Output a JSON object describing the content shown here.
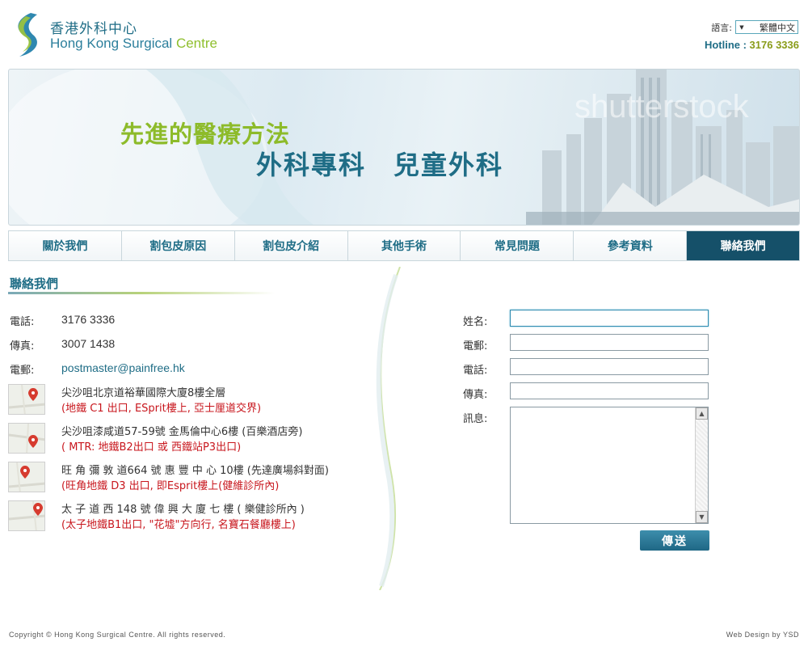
{
  "header": {
    "logo_cn": "香港外科中心",
    "logo_en_main": "Hong Kong Surgical ",
    "logo_en_accent": "Centre",
    "lang_label": "語言:",
    "lang_value": "繁體中文",
    "hotline_label": "Hotline : ",
    "hotline_number": "3176 3336"
  },
  "banner": {
    "line1": "先進的醫療方法",
    "line2": "外科專科　兒童外科",
    "watermark": "shutterstock"
  },
  "nav": {
    "items": [
      {
        "label": "關於我們"
      },
      {
        "label": "割包皮原因"
      },
      {
        "label": "割包皮介紹"
      },
      {
        "label": "其他手術"
      },
      {
        "label": "常見問題"
      },
      {
        "label": "參考資料"
      },
      {
        "label": "聯絡我們"
      }
    ],
    "active_index": 6
  },
  "contact": {
    "title": "聯絡我們",
    "phone_label": "電話:",
    "phone": "3176 3336",
    "fax_label": "傳真:",
    "fax": "3007 1438",
    "email_label": "電郵:",
    "email": "postmaster@painfree.hk",
    "addresses": [
      {
        "line1": "尖沙咀北京道裕華國際大廈8樓全層",
        "line2": "(地鐵 C1 出口, ESprit樓上, 亞士厘道交界)"
      },
      {
        "line1": "尖沙咀漆咸道57-59號 金馬倫中心6樓 (百樂酒店旁)",
        "line2": "( MTR: 地鐵B2出口 或 西鐵站P3出口)"
      },
      {
        "line1": "旺 角 彌 敦 道664 號 惠 豐 中 心 10樓 (先達廣場斜對面)",
        "line2": "(旺角地鐵 D3 出口, 即Esprit樓上(健維診所內)"
      },
      {
        "line1": "太 子 道 西 148 號 偉 興 大 廈 七 樓 ( 樂健診所內 )",
        "line2": "(太子地鐵B1出口, \"花墟\"方向行, 名寶石餐廳樓上)"
      }
    ]
  },
  "form": {
    "name_label": "姓名:",
    "email_label": "電郵:",
    "phone_label": "電話:",
    "fax_label": "傳真:",
    "message_label": "訊息:",
    "name_value": "",
    "email_value": "",
    "phone_value": "",
    "fax_value": "",
    "submit_label": "傳送"
  },
  "footer": {
    "copyright": "Copyright © Hong Kong Surgical Centre. All rights reserved.",
    "credit": "Web Design by YSD"
  },
  "colors": {
    "brand_teal": "#1f6d86",
    "brand_green": "#8dbb2a",
    "nav_active": "#155069",
    "address_red": "#c8161d"
  }
}
